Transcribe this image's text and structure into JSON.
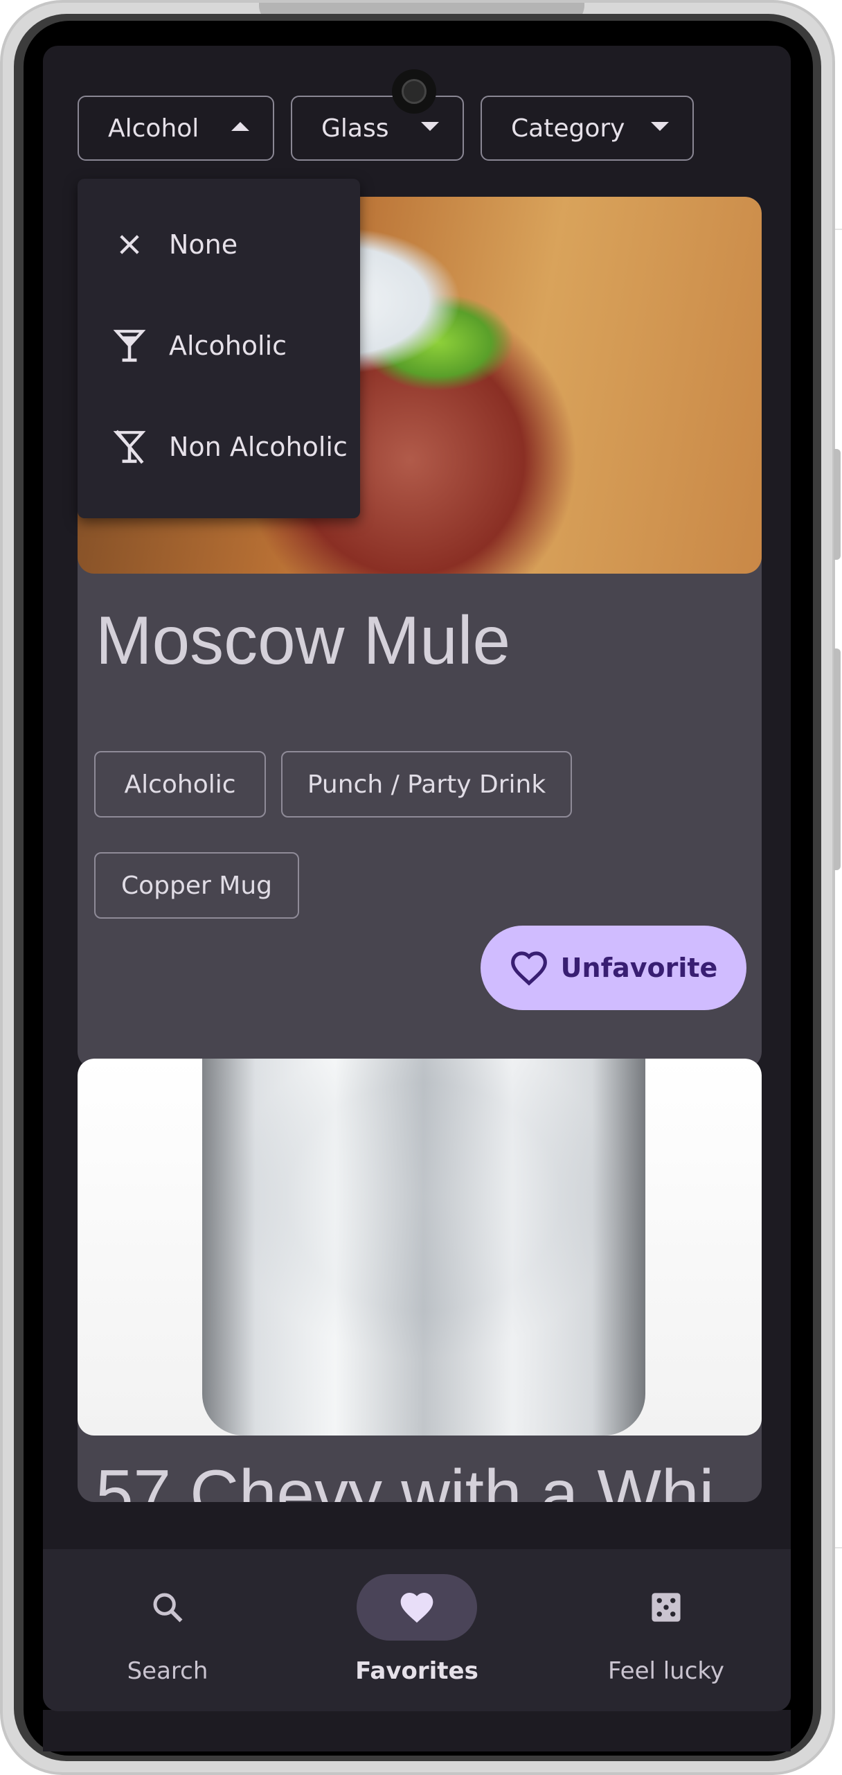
{
  "filters": [
    {
      "label": "Alcohol",
      "state": "open"
    },
    {
      "label": "Glass",
      "state": "closed"
    },
    {
      "label": "Category",
      "state": "closed"
    }
  ],
  "alcohol_menu": {
    "items": [
      {
        "label": "None",
        "icon": "close-icon"
      },
      {
        "label": "Alcoholic",
        "icon": "cocktail-glass-icon"
      },
      {
        "label": "Non Alcoholic",
        "icon": "no-alcohol-icon"
      }
    ]
  },
  "cards": [
    {
      "title": "Moscow Mule",
      "tags": [
        "Alcoholic",
        "Punch / Party Drink",
        "Copper Mug"
      ],
      "favorite_label": "Unfavorite"
    },
    {
      "title": "57 Chevy with a Whi"
    }
  ],
  "bottom_nav": {
    "items": [
      {
        "label": "Search",
        "icon": "search-icon"
      },
      {
        "label": "Favorites",
        "icon": "heart-icon",
        "selected": true
      },
      {
        "label": "Feel lucky",
        "icon": "dice-icon"
      }
    ]
  },
  "colors": {
    "background": "#1d1b22",
    "card": "#48454f",
    "accent": "#d0bcff",
    "accent_text": "#381e72",
    "nav_active_pill": "#4a4458"
  }
}
